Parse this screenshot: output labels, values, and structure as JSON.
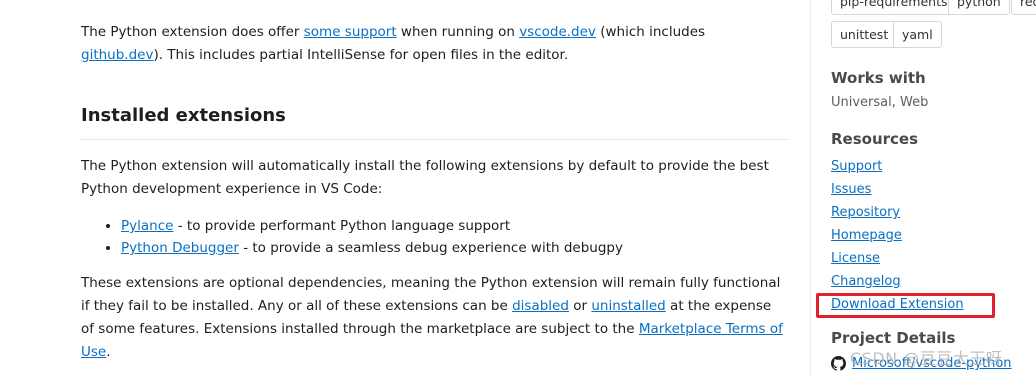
{
  "main": {
    "intro": {
      "t1": "The Python extension does offer ",
      "link1": "some support",
      "t2": " when running on ",
      "link2": "vscode.dev",
      "t3": " (which includes ",
      "link3": "github.dev",
      "t4": "). This includes partial IntelliSense for open files in the editor."
    },
    "heading": "Installed extensions",
    "auto_install_text": "The Python extension will automatically install the following extensions by default to provide the best Python development experience in VS Code:",
    "bullets": [
      {
        "link": "Pylance",
        "text": " - to provide performant Python language support"
      },
      {
        "link": "Python Debugger",
        "text": " - to provide a seamless debug experience with debugpy"
      }
    ],
    "optional": {
      "t1": "These extensions are optional dependencies, meaning the Python extension will remain fully functional if they fail to be installed. Any or all of these extensions can be ",
      "link1": "disabled",
      "t2": " or ",
      "link2": "uninstalled",
      "t3": " at the expense of some features. Extensions installed through the marketplace are subject to the ",
      "link3": "Marketplace Terms of Use",
      "t4": "."
    }
  },
  "sidebar": {
    "tags": [
      "pip-requirements",
      "python",
      "req",
      "unittest",
      "yaml"
    ],
    "works_with_title": "Works with",
    "works_with_value": "Universal, Web",
    "resources_title": "Resources",
    "resources": [
      "Support",
      "Issues",
      "Repository",
      "Homepage",
      "License",
      "Changelog",
      "Download Extension"
    ],
    "project_details_title": "Project Details",
    "repo_link": "Microsoft/vscode-python"
  },
  "watermark": "CSDN @豆豆大王呀",
  "colors": {
    "link": "#0a6fc2",
    "highlight_box": "#e0202a"
  },
  "icons": {
    "repo": "github-icon"
  }
}
